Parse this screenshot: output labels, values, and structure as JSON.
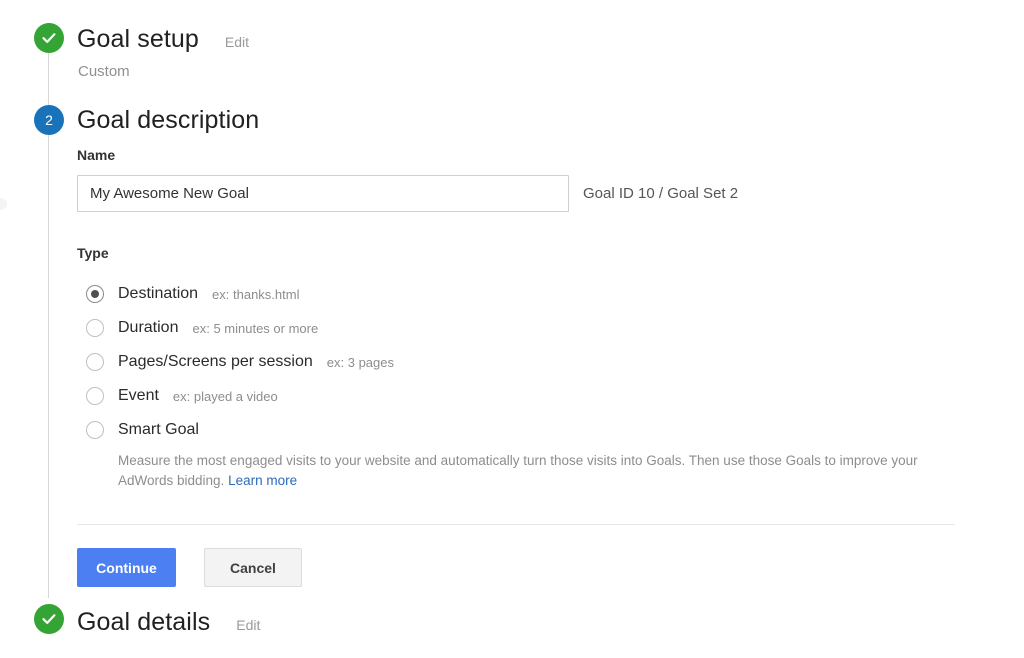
{
  "colors": {
    "step_done": "#34a534",
    "step_active": "#1a73b8",
    "primary_button": "#4b7ff2",
    "link": "#2a6bbd",
    "rail": "#d8d8d8"
  },
  "steps": [
    {
      "marker": "check-icon",
      "state": "complete",
      "title": "Goal setup",
      "edit_label": "Edit",
      "subtitle": "Custom"
    },
    {
      "marker": "2",
      "state": "active",
      "title": "Goal description",
      "edit_label": ""
    },
    {
      "marker": "check-icon",
      "state": "complete",
      "title": "Goal details",
      "edit_label": "Edit"
    }
  ],
  "form": {
    "name_label": "Name",
    "name_value": "My Awesome New Goal",
    "name_placeholder": "Name",
    "goal_id_text": "Goal ID 10 / Goal Set 2",
    "type_label": "Type",
    "types": [
      {
        "label": "Destination",
        "example": "ex: thanks.html",
        "selected": true
      },
      {
        "label": "Duration",
        "example": "ex: 5 minutes or more",
        "selected": false
      },
      {
        "label": "Pages/Screens per session",
        "example": "ex: 3 pages",
        "selected": false
      },
      {
        "label": "Event",
        "example": "ex: played a video",
        "selected": false
      },
      {
        "label": "Smart Goal",
        "example": "",
        "selected": false
      }
    ],
    "smart_goal_description": "Measure the most engaged visits to your website and automatically turn those visits into Goals. Then use those Goals to improve your AdWords bidding.",
    "smart_goal_link": "Learn more"
  },
  "actions": {
    "continue_label": "Continue",
    "cancel_label": "Cancel"
  }
}
